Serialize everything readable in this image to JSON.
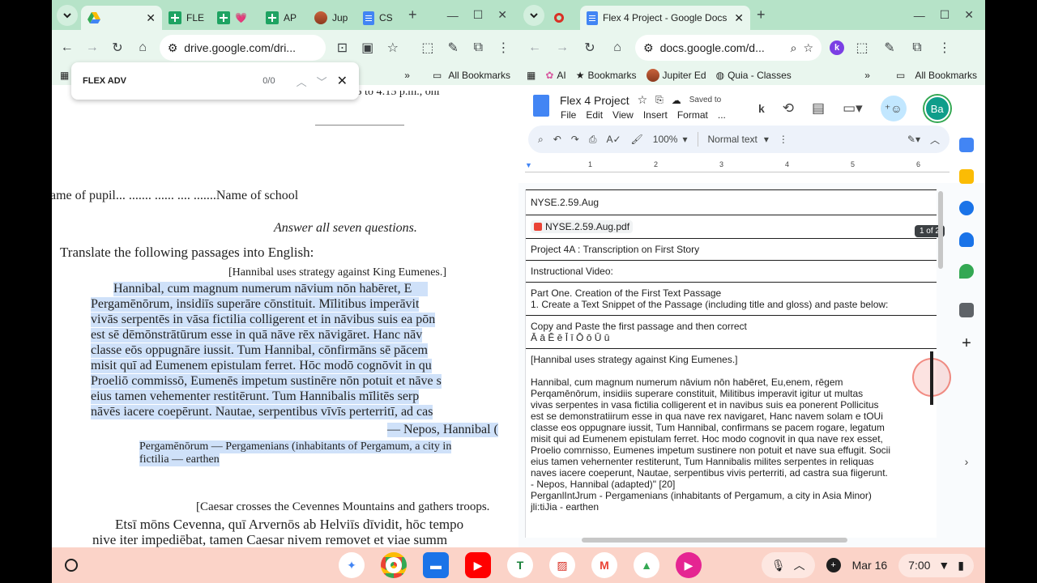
{
  "left_window": {
    "tabs": [
      {
        "label": "",
        "icon": "drive-icon",
        "active": true
      },
      {
        "label": "FLE",
        "icon": "sheets-icon"
      },
      {
        "label": "💗",
        "icon": "sheets-icon"
      },
      {
        "label": "AP",
        "icon": "sheets-icon"
      },
      {
        "label": "Jup",
        "icon": "jupiter-icon"
      },
      {
        "label": "CS",
        "icon": "docs-icon"
      }
    ],
    "url": "drive.google.com/dri...",
    "bookmarks_more": "»",
    "all_bookmarks": "All Bookmarks",
    "find": {
      "query": "FLEX ADV",
      "count": "0/0"
    },
    "scan": {
      "top_line": "—, —— —— ——, ·—1:15 to 4:15 p.m., onl",
      "pupil_line": "ame of pupil...  ....... ...... .... .......Name of school",
      "instruction": "Answer all seven questions.",
      "translate": "Translate the following passages into English:",
      "heading1": "[Hannibal uses strategy against King Eumenes.]",
      "para1": [
        "Hannibal, cum magnum numerum nāvium nōn habēret, E",
        "Pergamēnōrum, insidiīs superāre cōnstituit.  Mīlitibus imperāvit",
        "vivās serpentēs in vāsa fictilia colligerent et in nāvibus suis ea pōn",
        "est sē dēmōnstrātūrum esse in quā nāve rēx nāvigāret.  Hanc nāv",
        "classe eōs oppugnāre iussit.  Tum Hannibal, cōnfirmāns sē pācem",
        "misit quī ad Eumenem epistulam ferret.  Hōc modō cognōvit in qu",
        "Proeliō commissō, Eumenēs impetum sustinēre nōn potuit et nāve s",
        "eius tamen vehementer restitērunt.  Tum Hannibalis mīlitēs serp",
        "nāvēs iacere coepērunt.   Nautae, serpentibus vīvīs perterritī, ad cas"
      ],
      "attribution": "— Nepos, Hannibal (",
      "gloss1": "Pergamēnōrum — Pergamenians (inhabitants of Pergamum, a city in",
      "gloss2": "fictilia — earthen",
      "heading2": "[Caesar crosses the Cevennes Mountains and gathers troops.",
      "para2": [
        "Etsī mōns Cevenna, quī Arvernōs ab Helviīs dīvidit, hōc tempo",
        "nive iter impediēbat, tamen Caesar nivem removet et viae summ"
      ]
    }
  },
  "right_window": {
    "tab_title": "Flex 4 Project - Google Docs",
    "url": "docs.google.com/d...",
    "bookmarks": [
      "AI",
      "Bookmarks",
      "Jupiter Ed",
      "Quia - Classes"
    ],
    "bookmarks_more": "»",
    "all_bookmarks": "All Bookmarks",
    "doc_title": "Flex 4 Project",
    "saved": "Saved to",
    "menus": [
      "File",
      "Edit",
      "View",
      "Insert",
      "Format",
      "..."
    ],
    "zoom": "100%",
    "style": "Normal text",
    "avatar": "Ba",
    "ruler_marks": [
      "1",
      "2",
      "3",
      "4",
      "5",
      "6"
    ],
    "page_badge": "1 of 2",
    "cells": {
      "c1": "NYSE.2.59.Aug",
      "c2_chip": "NYSE.2.59.Aug.pdf",
      "c3": "Project 4A : Transcription on First Story",
      "c4": "Instructional Video:",
      "c5_line1": "Part One. Creation of the First Text Passage",
      "c5_line2": "1. Create a Text Snippet of the Passage (including title and gloss) and paste below:",
      "c6_line1": "Copy and Paste the first passage and then correct",
      "c6_line2": "Ā ā Ē ē Ī ī Ō ō Ū ū",
      "c7_heading": "[Hannibal uses strategy against King Eumenes.]",
      "c7_body": [
        "Hannibal, cum magnum numerum nāvium nōn habēret, Eu,enem, rēgem",
        "Perqamēnōrum, insidiis superare constituit, Militibus imperavit igitur ut multas",
        "vivas serpentes in vasa fictilia colligerent et in navibus suis ea ponerent Pollicitus",
        "est se demonstratiirum esse in qua nave rex navigaret, Hanc navem solam e tOUi",
        "classe eos oppugnare iussit, Tum Hannibal, confirmans se pacem rogare, legatum",
        "misit qui ad Eumenem epistulam ferret. Hoc modo cognovit in qua nave rex esset,",
        "Proelio comrnisso, Eumenes impetum sustinere non potuit et nave sua effugit. Socii",
        "eius tamen vehernenter restiterunt, Tum Hannibalis milites serpentes in reliquas",
        "naves iacere coeperunt, Nautae, serpentibus vivis perterriti, ad castra sua fiigerunt.",
        "- Nepos, Hannibal (adapted)\" [20]",
        "PerganlIntJrum - Pergamenians (inhabitants of Pergamum, a city in Asia Minor)",
        "jli:tiJia - earthen"
      ]
    }
  },
  "shelf": {
    "date": "Mar 16",
    "time": "7:00"
  },
  "colors": {
    "chrome_frame": "#b6e3c8",
    "chrome_toolbar": "#e9f6ee",
    "shelf": "#fbd3c8",
    "highlight": "#cfe1f9",
    "avatar_bg": "#0f9d8a"
  }
}
